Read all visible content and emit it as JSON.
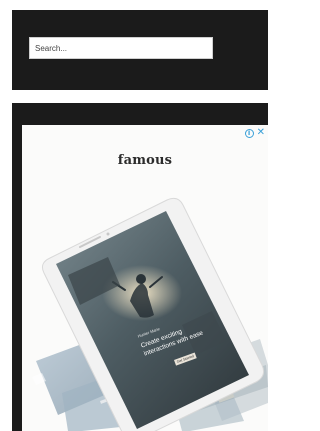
{
  "search": {
    "placeholder": "Search...",
    "value": ""
  },
  "ad": {
    "brand": "famous",
    "info_icon": "info-icon",
    "close_icon": "close-icon",
    "info_glyph": "i",
    "close_glyph": "✕",
    "phone_screen": {
      "caption_small": "Hunter Marie",
      "line1": "Create exciting",
      "line2": "interactions with ease",
      "cta": "Get Started"
    },
    "colors": {
      "adchoices": "#3aa0d8",
      "panel": "#1b1b1b",
      "frame": "#fbfbfa"
    }
  }
}
